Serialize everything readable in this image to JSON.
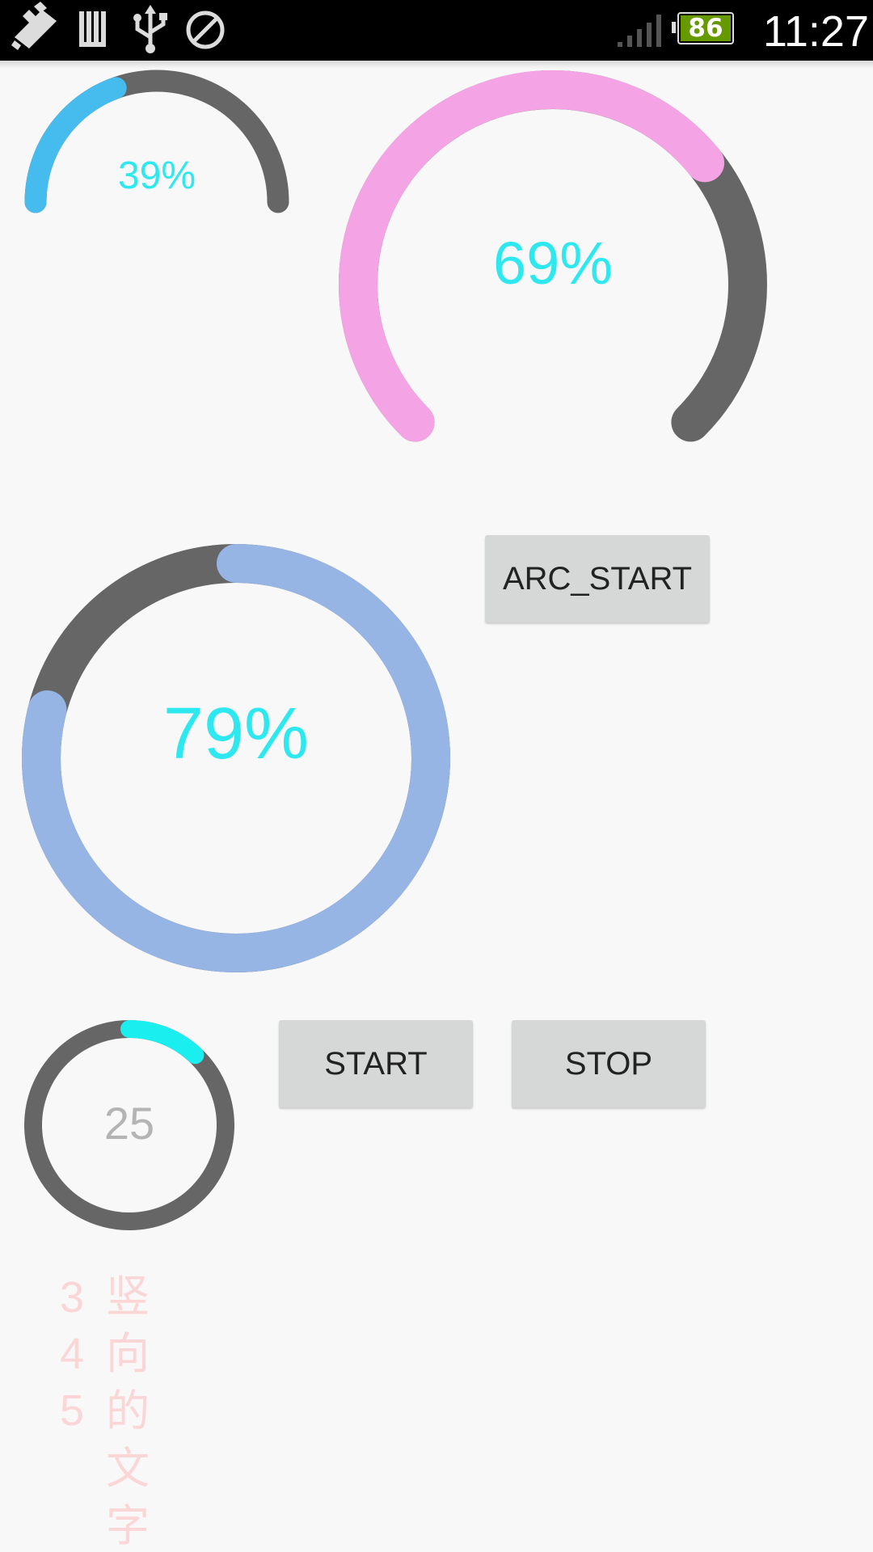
{
  "status_bar": {
    "icons": [
      "usb-debug-icon",
      "storage-icon",
      "usb-icon",
      "no-sim-icon",
      "signal-icon",
      "battery-icon"
    ],
    "battery_level": "86",
    "time": "11:27",
    "colors": {
      "battery_fill": "#669900"
    }
  },
  "gauges": {
    "small_arc": {
      "label": "39%",
      "progress": 0.39,
      "sweep_degrees": 180,
      "color": "#46bbee",
      "track_color": "#666666",
      "text_color": "#2ee8ef"
    },
    "large_arc": {
      "label": "69%",
      "progress": 0.69,
      "sweep_degrees": 270,
      "color": "#f4a4e4",
      "track_color": "#666666",
      "text_color": "#2ee8ef"
    },
    "big_ring": {
      "label": "79%",
      "progress": 0.79,
      "sweep_degrees": 360,
      "color": "#96b4e4",
      "track_color": "#666666",
      "text_color": "#2ee8ef"
    },
    "small_ring": {
      "label": "25",
      "progress": 0.12,
      "sweep_degrees": 360,
      "color": "#1beeee",
      "track_color": "#666666",
      "text_color": "#b4b4b4"
    }
  },
  "buttons": {
    "arc_start": "ARC_START",
    "start": "START",
    "stop": "STOP"
  },
  "vertical_text": {
    "numbers": [
      "3",
      "4",
      "5"
    ],
    "characters": [
      "竖",
      "向",
      "的",
      "文",
      "字"
    ],
    "color": "#fbd6d6"
  }
}
